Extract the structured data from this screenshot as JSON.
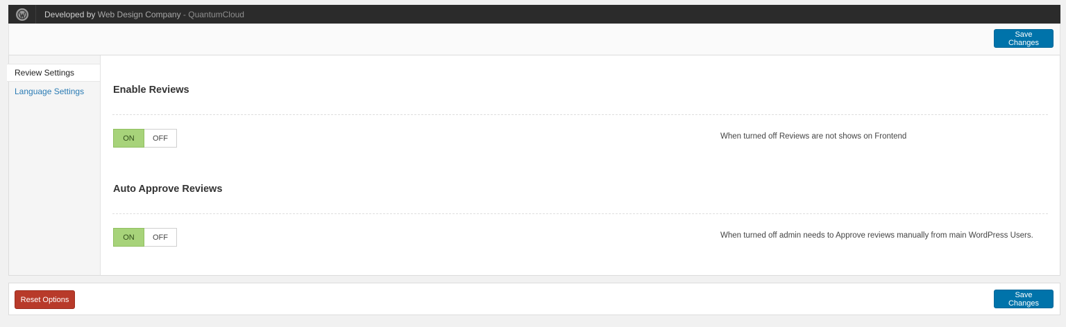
{
  "topbar": {
    "developed_by": "Developed by",
    "company_link": "Web Design Company",
    "separator": " - ",
    "company_name": "QuantumCloud"
  },
  "header": {
    "save_label": "Save Changes"
  },
  "sidebar": {
    "items": [
      {
        "label": "Review Settings",
        "active": true
      },
      {
        "label": "Language Settings",
        "active": false
      }
    ]
  },
  "sections": [
    {
      "title": "Enable Reviews",
      "toggle_on": "ON",
      "toggle_off": "OFF",
      "state": "ON",
      "description": "When turned off Reviews are not shows on Frontend"
    },
    {
      "title": "Auto Approve Reviews",
      "toggle_on": "ON",
      "toggle_off": "OFF",
      "state": "ON",
      "description": "When turned off admin needs to Approve reviews manually from main WordPress Users."
    }
  ],
  "footer": {
    "reset_label": "Reset Options",
    "save_label": "Save Changes"
  },
  "colors": {
    "primary": "#0073aa",
    "danger": "#b83a2a",
    "toggle_on": "#a7d37a",
    "topbar": "#2b2b2b"
  }
}
